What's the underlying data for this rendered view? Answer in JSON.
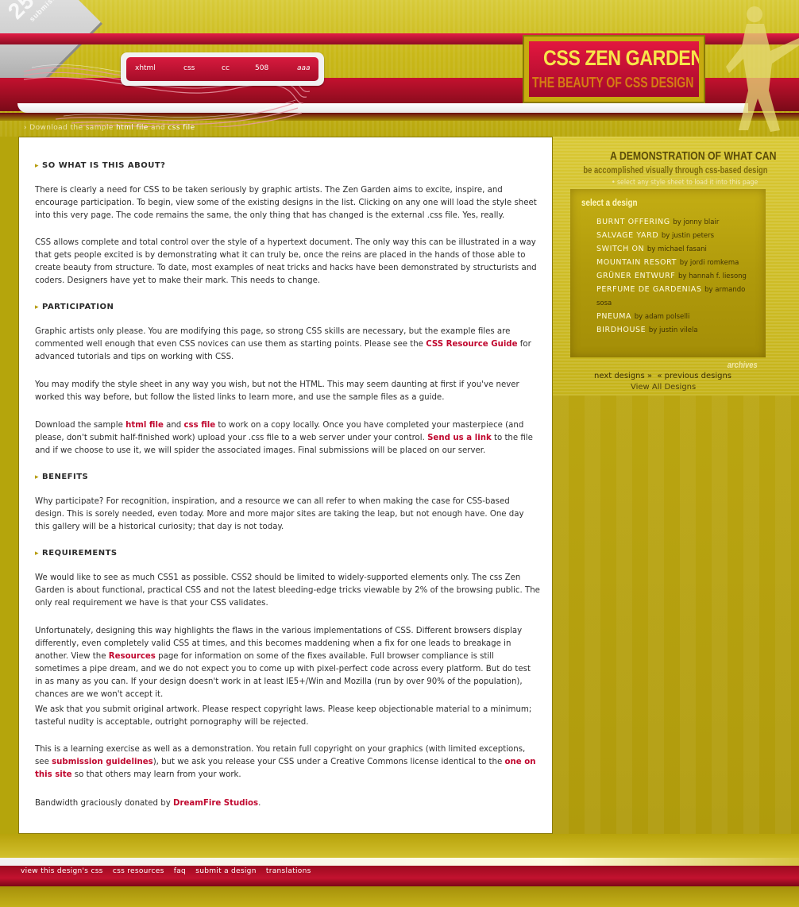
{
  "badge": {
    "number": "25",
    "text": "submissions"
  },
  "acronyms": [
    "xhtml",
    "css",
    "cc",
    "508",
    "aaa"
  ],
  "logo": {
    "title": "CSS ZEN GARDEN",
    "subtitle": "THE BEAUTY OF CSS DESIGN"
  },
  "download_line": {
    "prefix": "Download the sample ",
    "html": "html file",
    "and": " and ",
    "css": "css file"
  },
  "sections": [
    {
      "title": "SO WHAT IS THIS ABOUT?",
      "paragraphs": [
        "There is clearly a need for CSS to be taken seriously by graphic artists. The Zen Garden aims to excite, inspire, and encourage participation. To begin, view some of the existing designs in the list. Clicking on any one will load the style sheet into this very page. The code remains the same, the only thing that has changed is the external .css file. Yes, really.",
        "CSS allows complete and total control over the style of a hypertext document. The only way this can be illustrated in a way that gets people excited is by demonstrating what it can truly be, once the reins are placed in the hands of those able to create beauty from structure. To date, most examples of neat tricks and hacks have been demonstrated by structurists and coders. Designers have yet to make their mark. This needs to change."
      ]
    },
    {
      "title": "PARTICIPATION",
      "p1_before": "Graphic artists only please. You are modifying this page, so strong CSS skills are necessary, but the example files are commented well enough that even CSS novices can use them as starting points. Please see the ",
      "p1_link": "CSS Resource Guide",
      "p1_after": " for advanced tutorials and tips on working with CSS.",
      "p2": "You may modify the style sheet in any way you wish, but not the HTML. This may seem daunting at first if you've never worked this way before, but follow the listed links to learn more, and use the sample files as a guide.",
      "p3_a": "Download the sample ",
      "p3_link1": "html file",
      "p3_b": " and ",
      "p3_link2": "css file",
      "p3_c": " to work on a copy locally. Once you have completed your masterpiece (and please, don't submit half-finished work) upload your .css file to a web server under your control. ",
      "p3_link3": "Send us a link",
      "p3_d": " to the file and if we choose to use it, we will spider the associated images. Final submissions will be placed on our server."
    },
    {
      "title": "BENEFITS",
      "p1": "Why participate? For recognition, inspiration, and a resource we can all refer to when making the case for CSS-based design. This is sorely needed, even today. More and more major sites are taking the leap, but not enough have. One day this gallery will be a historical curiosity; that day is not today."
    },
    {
      "title": "REQUIREMENTS",
      "p1": "We would like to see as much CSS1 as possible. CSS2 should be limited to widely-supported elements only. The css Zen Garden is about functional, practical CSS and not the latest bleeding-edge tricks viewable by 2% of the browsing public. The only real requirement we have is that your CSS validates.",
      "p2_a": "Unfortunately, designing this way highlights the flaws in the various implementations of CSS. Different browsers display differently, even completely valid CSS at times, and this becomes maddening when a fix for one leads to breakage in another. View the ",
      "p2_link": "Resources",
      "p2_b": " page for information on some of the fixes available. Full browser compliance is still sometimes a pipe dream, and we do not expect you to come up with pixel-perfect code across every platform. But do test in as many as you can. If your design doesn't work in at least IE5+/Win and Mozilla (run by over 90% of the population), chances are we won't accept it.",
      "p3": "We ask that you submit original artwork. Please respect copyright laws. Please keep objectionable material to a minimum; tasteful nudity is acceptable, outright pornography will be rejected.",
      "p4_a": "This is a learning exercise as well as a demonstration. You retain full copyright on your graphics (with limited exceptions, see ",
      "p4_link1": "submission guidelines",
      "p4_b": "), but we ask you release your CSS under a Creative Commons license identical to the ",
      "p4_link2": "one on this site",
      "p4_c": " so that others may learn from your work.",
      "p5_a": "Bandwidth graciously donated by ",
      "p5_link": "DreamFire Studios",
      "p5_b": "."
    }
  ],
  "sidebar": {
    "demo_title": "A DEMONSTRATION OF WHAT CAN",
    "demo_sub": "be accomplished visually through css-based design",
    "hint": "select any style sheet to load it into this page",
    "heading": "select a design",
    "designs": [
      {
        "name": "BURNT OFFERING",
        "by": "by",
        "author": "jonny blair"
      },
      {
        "name": "SALVAGE YARD",
        "by": "by",
        "author": "justin peters"
      },
      {
        "name": "SWITCH ON",
        "by": "by",
        "author": "michael fasani"
      },
      {
        "name": "MOUNTAIN RESORT",
        "by": "by",
        "author": "jordi romkema"
      },
      {
        "name": "GRÜNER ENTWURF",
        "by": "by",
        "author": "hannah f. liesong"
      },
      {
        "name": "PERFUME DE GARDENIAS",
        "by": "by",
        "author": "armando"
      },
      {
        "name": "PNEUMA",
        "by": "by",
        "author": "adam polselli"
      },
      {
        "name": "BIRDHOUSE",
        "by": "by",
        "author": "justin vilela"
      }
    ],
    "design6_cont": "sosa",
    "archives": "archives",
    "next": "next designs »",
    "prev": "« previous designs",
    "view_all": "View All Designs"
  },
  "footer": {
    "links": [
      "view this design's css",
      "css resources",
      "faq",
      "submit a design",
      "translations"
    ]
  },
  "colors": {
    "accent_red": "#c0082f",
    "gold": "#b5a50c",
    "panel": "#ffffff"
  }
}
